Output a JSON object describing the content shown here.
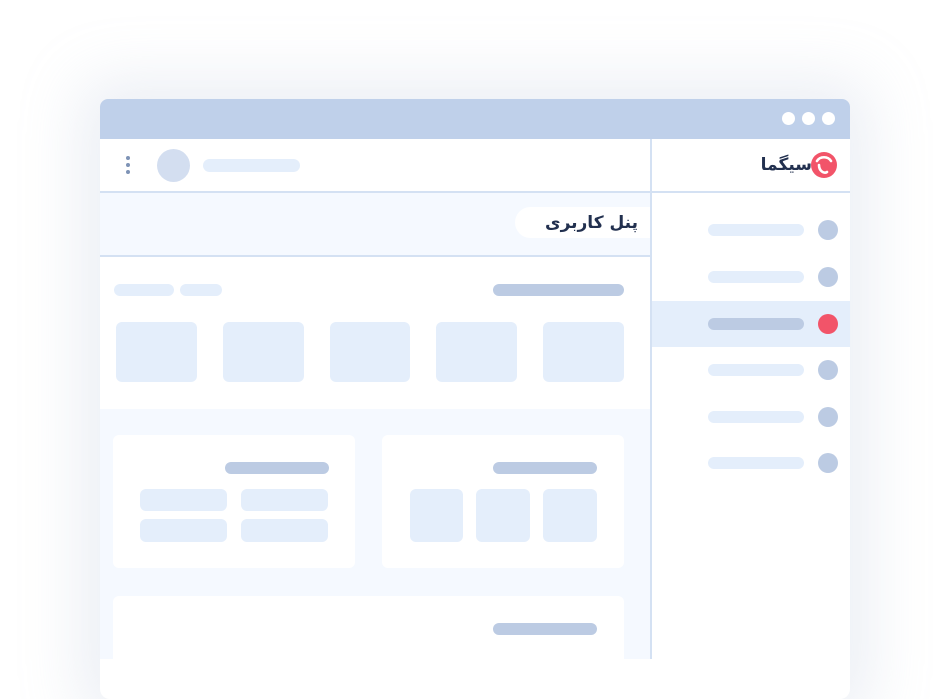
{
  "window": {
    "controls": [
      "window-dot-1",
      "window-dot-2",
      "window-dot-3"
    ]
  },
  "brand": {
    "name": "سیگما",
    "icon": "sigma-logo-icon",
    "accent": "#f25469"
  },
  "header": {
    "page_title": "پنل کاربری",
    "menu_icon": "kebab-menu-icon",
    "avatar_icon": "user-avatar"
  },
  "colors": {
    "titlebar": "#bfd0ea",
    "placeholder_light": "#e4eefb",
    "placeholder_dark": "#bccbe3",
    "active_dot": "#f25469",
    "panel_bg": "#f5f9ff"
  },
  "sidebar": {
    "items": [
      {
        "active": false
      },
      {
        "active": false
      },
      {
        "active": true
      },
      {
        "active": false
      },
      {
        "active": false
      },
      {
        "active": false
      }
    ]
  }
}
